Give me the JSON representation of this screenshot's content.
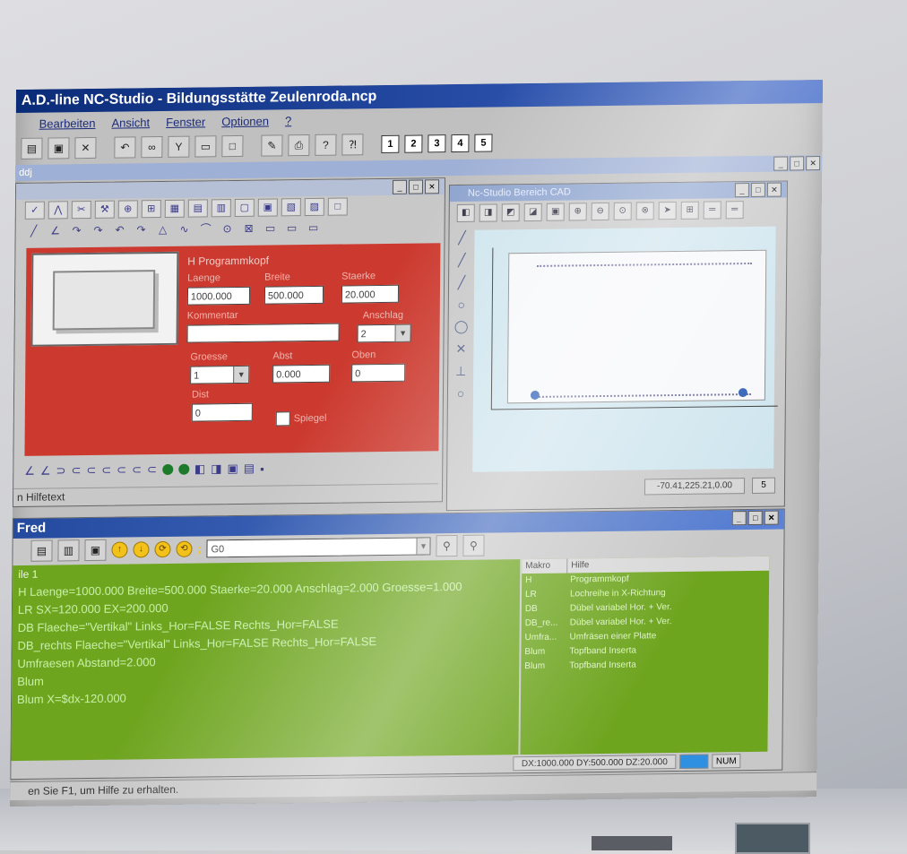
{
  "app": {
    "title": "A.D.-line NC-Studio - Bildungsstätte Zeulenroda.ncp"
  },
  "menu": [
    "Bearbeiten",
    "Ansicht",
    "Fenster",
    "Optionen",
    "?"
  ],
  "toolbar": {
    "numbers": [
      "1",
      "2",
      "3",
      "4",
      "5"
    ]
  },
  "mdi_label": "ddj",
  "left_panel": {
    "title": "H Programmkopf",
    "labels": {
      "laenge": "Laenge",
      "breite": "Breite",
      "staerke": "Staerke",
      "kommentar": "Kommentar",
      "anschlag": "Anschlag",
      "groesse": "Groesse",
      "abst": "Abst",
      "oben": "Oben",
      "dist": "Dist"
    },
    "values": {
      "laenge": "1000.000",
      "breite": "500.000",
      "staerke": "20.000",
      "kommentar": "",
      "anschlag": "2",
      "groesse": "1",
      "abst": "0.000",
      "oben": "0",
      "dist": "0"
    },
    "spiegel_label": "Spiegel",
    "status": "n Hilfetext"
  },
  "cad": {
    "title": "Nc-Studio Bereich CAD",
    "coords": "-70.41,225.21,0.00",
    "page": "5"
  },
  "editor": {
    "title": "Fred",
    "combo_value": "G0",
    "lines": [
      "ile 1",
      "H Laenge=1000.000 Breite=500.000 Staerke=20.000 Anschlag=2.000 Groesse=1.000",
      "LR SX=120.000 EX=200.000",
      "DB Flaeche=\"Vertikal\" Links_Hor=FALSE Rechts_Hor=FALSE",
      "DB_rechts Flaeche=\"Vertikal\" Links_Hor=FALSE Rechts_Hor=FALSE",
      "Umfraesen Abstand=2.000",
      "Blum",
      "Blum X=$dx-120.000"
    ],
    "help_headers": [
      "Makro",
      "Hilfe"
    ],
    "help_rows": [
      [
        "H",
        "Programmkopf"
      ],
      [
        "LR",
        "Lochreihe in X-Richtung"
      ],
      [
        "DB",
        "Dübel variabel Hor. + Ver."
      ],
      [
        "DB_re...",
        "Dübel variabel Hor. + Ver."
      ],
      [
        "Umfra...",
        "Umfräsen einer Platte"
      ],
      [
        "Blum",
        "Topfband Inserta"
      ],
      [
        "Blum",
        "Topfband Inserta"
      ]
    ],
    "coords": "DX:1000.000 DY:500.000 DZ:20.000",
    "num": "NUM"
  },
  "status_bar": "en Sie F1, um Hilfe zu erhalten."
}
